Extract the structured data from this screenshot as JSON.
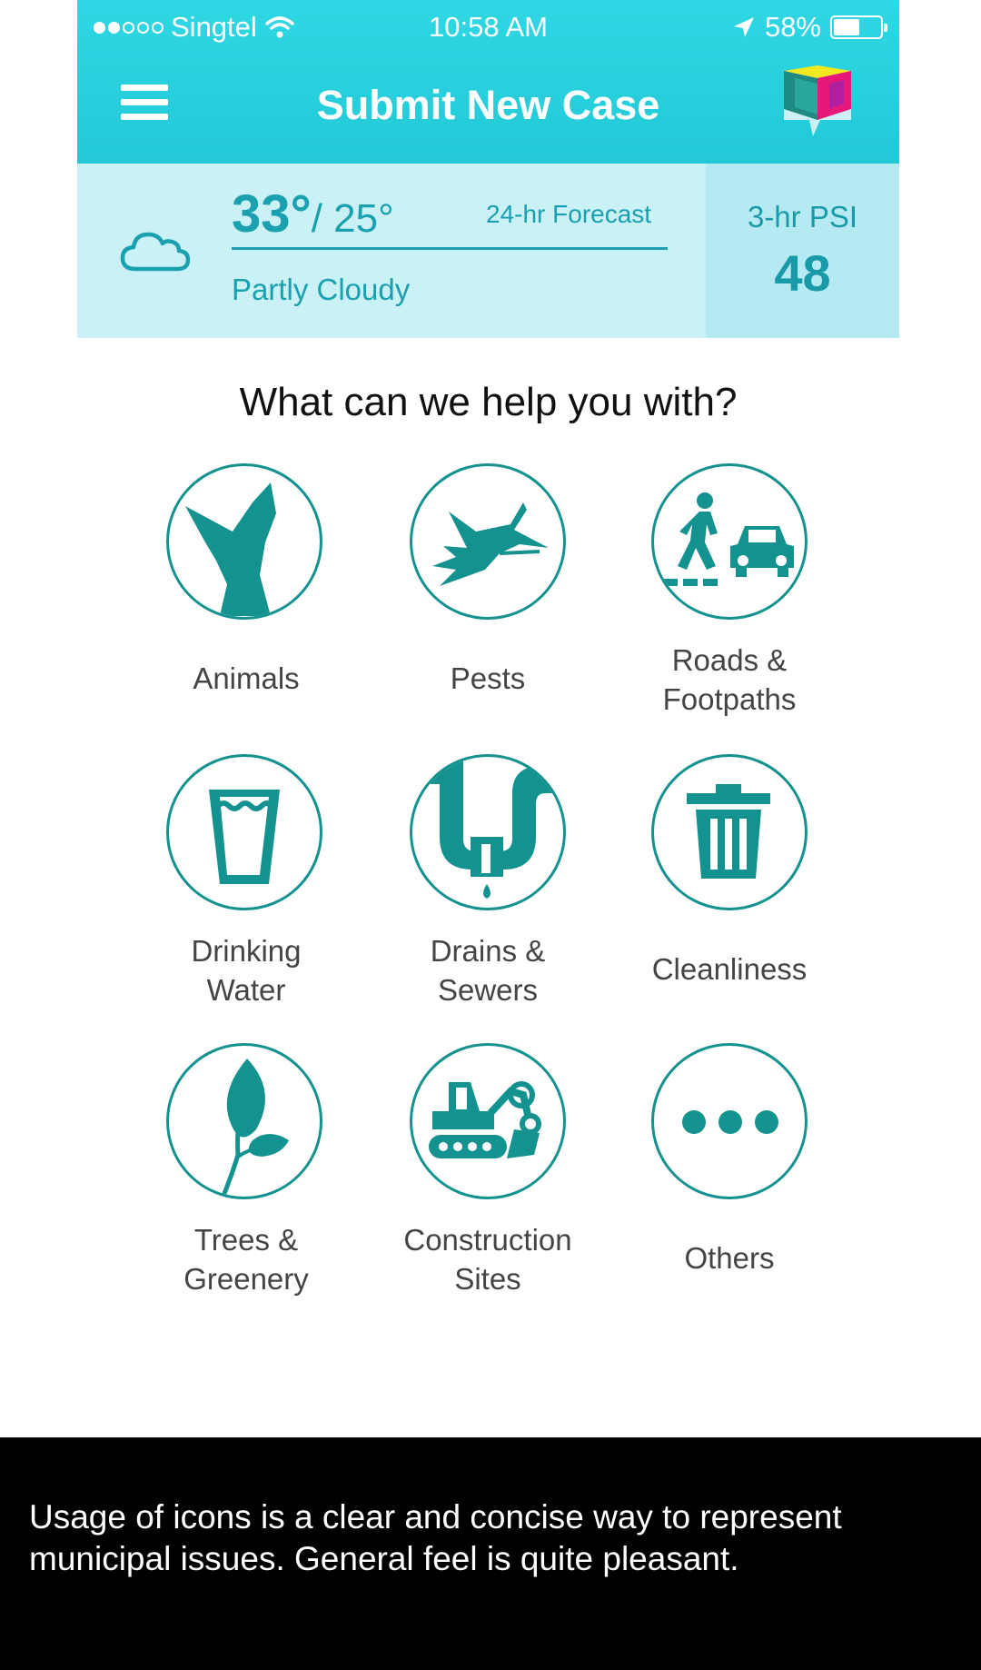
{
  "status_bar": {
    "carrier": "Singtel",
    "time": "10:58 AM",
    "battery": "58%",
    "battery_level": 0.58
  },
  "header": {
    "title": "Submit New Case",
    "menu_icon": "hamburger-menu-icon",
    "logo_icon": "app-logo-icon"
  },
  "weather": {
    "high": "33°",
    "low": "/ 25°",
    "forecast_label": "24-hr Forecast",
    "condition": "Partly Cloudy",
    "psi_label": "3-hr PSI",
    "psi_value": "48",
    "icon": "cloud-icon"
  },
  "help_title": "What can we help you with?",
  "categories": [
    {
      "line1": "Animals",
      "line2": "",
      "icon": "animal-icon"
    },
    {
      "line1": "Pests",
      "line2": "",
      "icon": "mosquito-icon"
    },
    {
      "line1": "Roads &",
      "line2": "Footpaths",
      "icon": "pedestrian-car-icon"
    },
    {
      "line1": "Drinking",
      "line2": "Water",
      "icon": "water-glass-icon"
    },
    {
      "line1": "Drains &",
      "line2": "Sewers",
      "icon": "pipe-drain-icon"
    },
    {
      "line1": "Cleanliness",
      "line2": "",
      "icon": "trash-bin-icon"
    },
    {
      "line1": "Trees &",
      "line2": "Greenery",
      "icon": "leaf-icon"
    },
    {
      "line1": "Construction",
      "line2": "Sites",
      "icon": "excavator-icon"
    },
    {
      "line1": "Others",
      "line2": "",
      "icon": "more-dots-icon"
    }
  ],
  "caption": "Usage of icons is a clear and concise way to represent municipal issues. General feel is quite pleasant.",
  "colors": {
    "accent": "#22c8d6",
    "icon_teal": "#14928f",
    "weather_bg": "#c9f1f6",
    "psi_bg": "#b5eaf2"
  }
}
